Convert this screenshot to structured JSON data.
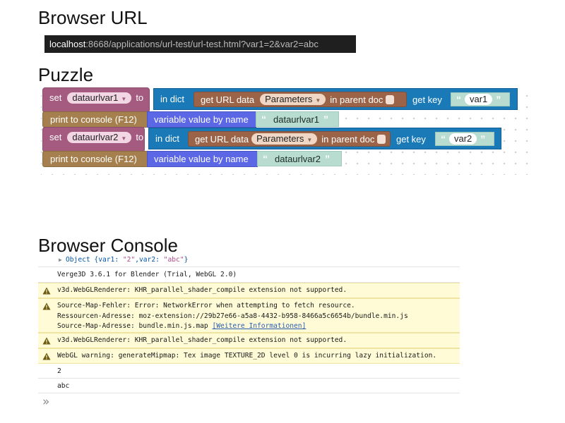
{
  "sections": {
    "browser_url": "Browser URL",
    "puzzle": "Puzzle",
    "browser_console": "Browser Console"
  },
  "url": {
    "host": "localhost",
    "rest": ":8668/applications/url-test/url-test.html?var1=2&var2=abc"
  },
  "puzzle": {
    "rows": [
      {
        "set_label": "set",
        "var_name": "dataurlvar1",
        "to_label": "to",
        "dict_label": "in dict",
        "url_label": "get URL data",
        "url_dropdown": "Parameters",
        "parent_label": "in parent doc",
        "key_label": "get key",
        "key_value": "var1",
        "print_label": "print to console (F12)",
        "varval_label": "variable value by name",
        "varval_text": "dataurlvar1"
      },
      {
        "set_label": "set",
        "var_name": "dataurlvar2",
        "to_label": "to",
        "dict_label": "in dict",
        "url_label": "get URL data",
        "url_dropdown": "Parameters",
        "parent_label": "in parent doc",
        "key_label": "get key",
        "key_value": "var2",
        "print_label": "print to console (F12)",
        "varval_label": "variable value by name",
        "varval_text": "dataurlvar2"
      }
    ],
    "colors": {
      "set": "#a55b80",
      "print": "#a5804e",
      "dict": "#1a7ab8",
      "url": "#9b6448",
      "var": "#5b67e4",
      "text": "#b8dcd0"
    }
  },
  "console": {
    "object_line": {
      "prefix": "Object { ",
      "k1": "var1",
      "v1": "\"2\"",
      "sep": ", ",
      "k2": "var2",
      "v2": "\"abc\"",
      "suffix": " }"
    },
    "version": "Verge3D 3.6.1 for Blender (Trial, WebGL 2.0)",
    "warn1": "v3d.WebGLRenderer: KHR_parallel_shader_compile extension not supported.",
    "sourcemap": {
      "line1": "Source-Map-Fehler: Error: NetworkError when attempting to fetch resource.",
      "line2": "Ressourcen-Adresse: moz-extension://29b27e66-a5a8-4432-b958-8466a5c6654b/bundle.min.js",
      "line3_prefix": "Source-Map-Adresse: bundle.min.js.map ",
      "link": "[Weitere Informationen]"
    },
    "warn2": "v3d.WebGLRenderer: KHR_parallel_shader_compile extension not supported.",
    "warn3": "WebGL warning: generateMipmap: Tex image TEXTURE_2D level 0 is incurring lazy initialization.",
    "out1": "2",
    "out2": "abc",
    "prompt": "»",
    "warn_color": "#fefbd6"
  }
}
